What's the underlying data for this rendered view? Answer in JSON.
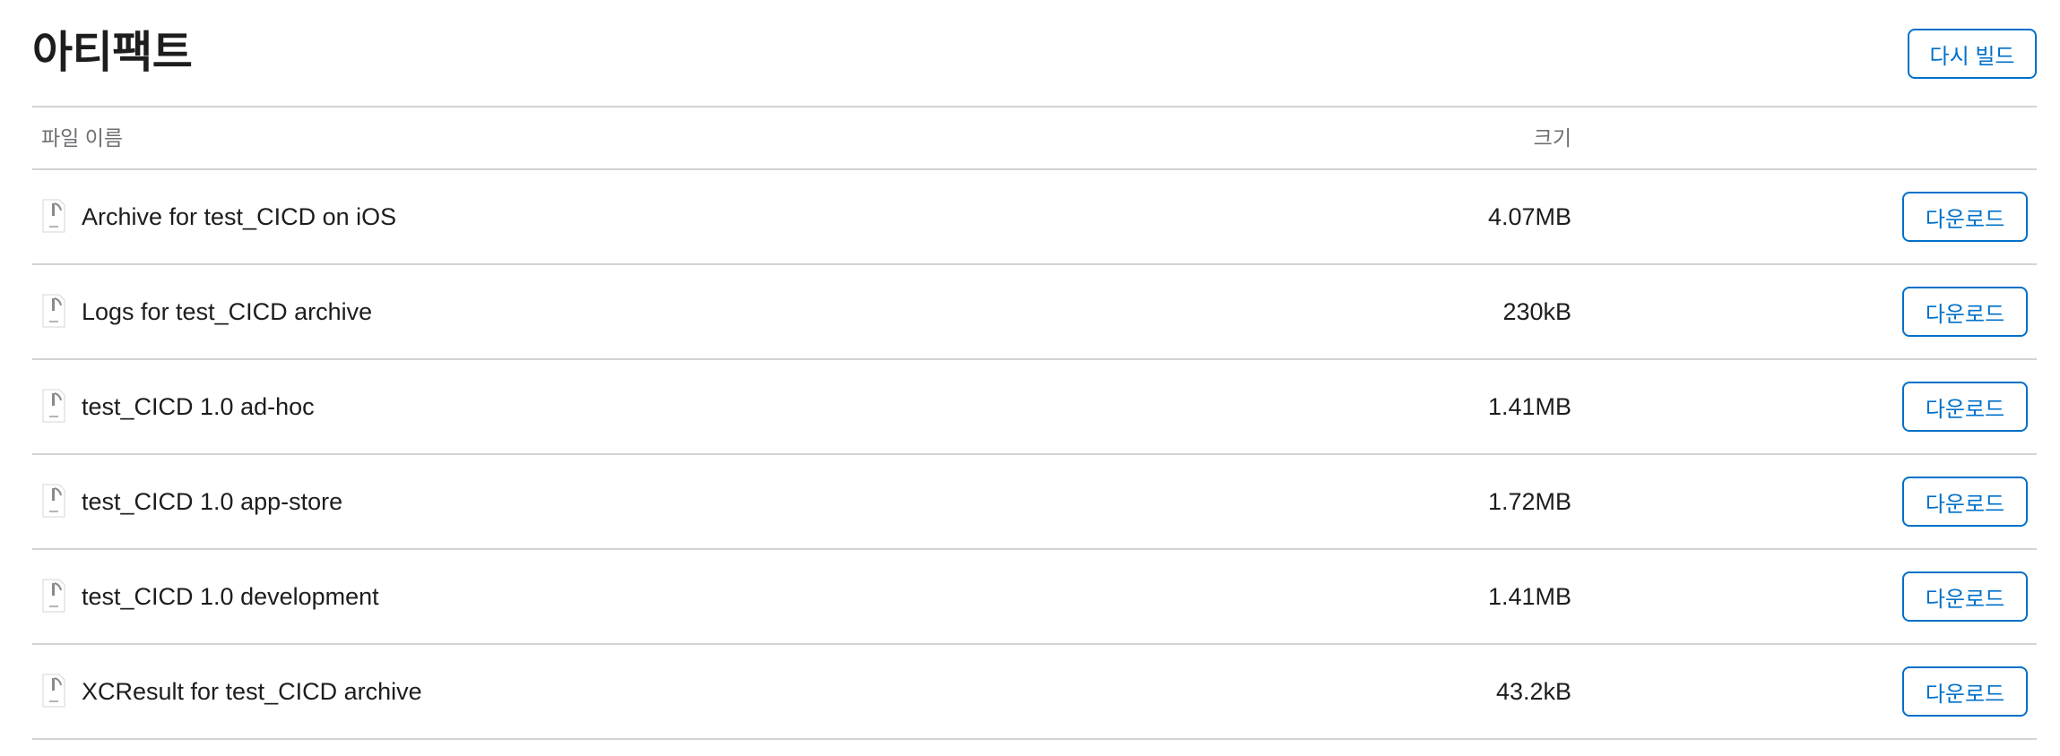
{
  "header": {
    "title": "아티팩트",
    "rebuild_label": "다시 빌드"
  },
  "table": {
    "columns": {
      "name": "파일 이름",
      "size": "크기"
    },
    "rows": [
      {
        "name": "Archive for test_CICD on iOS",
        "size": "4.07MB",
        "action": "다운로드",
        "icon": "document-icon"
      },
      {
        "name": "Logs for test_CICD archive",
        "size": "230kB",
        "action": "다운로드",
        "icon": "document-icon"
      },
      {
        "name": "test_CICD 1.0 ad-hoc",
        "size": "1.41MB",
        "action": "다운로드",
        "icon": "document-icon"
      },
      {
        "name": "test_CICD 1.0 app-store",
        "size": "1.72MB",
        "action": "다운로드",
        "icon": "document-icon"
      },
      {
        "name": "test_CICD 1.0 development",
        "size": "1.41MB",
        "action": "다운로드",
        "icon": "document-icon"
      },
      {
        "name": "XCResult for test_CICD archive",
        "size": "43.2kB",
        "action": "다운로드",
        "icon": "document-icon"
      }
    ]
  },
  "colors": {
    "accent": "#0070c9",
    "text": "#1d1d1f",
    "muted": "#6e6e73",
    "divider": "#d2d2d7"
  }
}
